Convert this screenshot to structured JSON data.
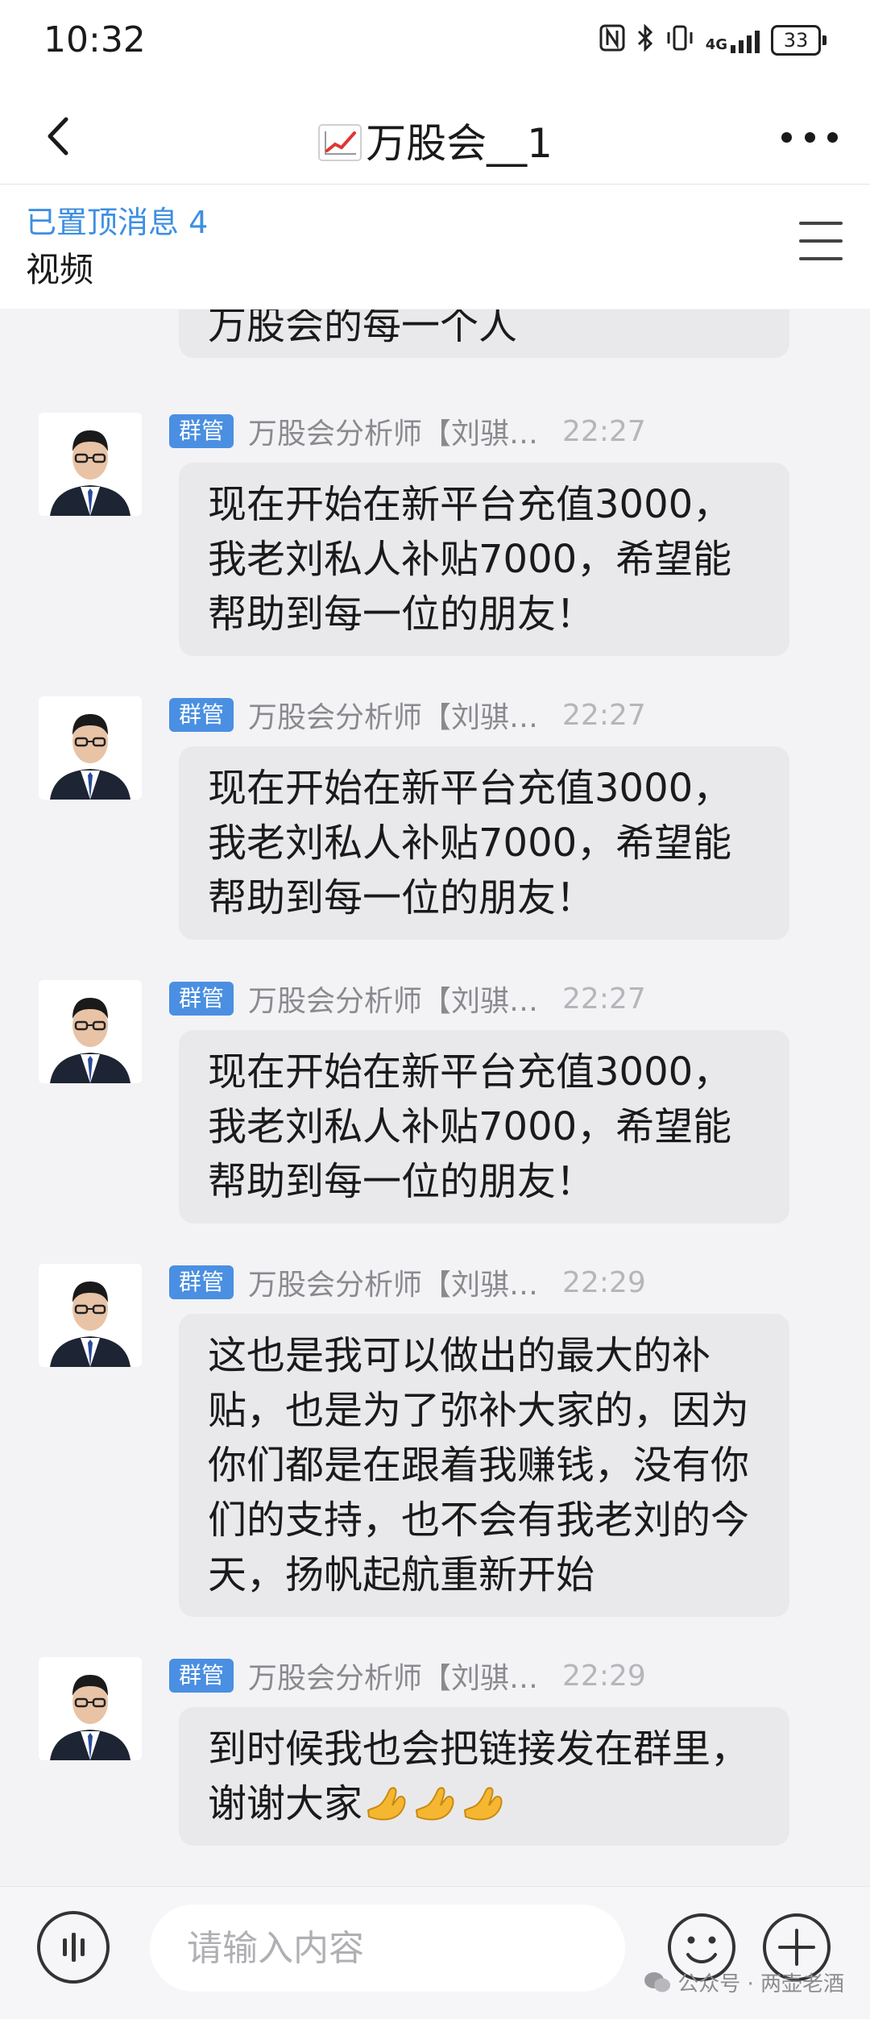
{
  "status_bar": {
    "time": "10:32",
    "network_label": "4G",
    "battery": "33",
    "icons": [
      "nfc-icon",
      "bluetooth-icon",
      "vibrate-icon",
      "signal-icon",
      "battery-icon"
    ]
  },
  "header": {
    "title": "万股会__1",
    "title_icon": "chart-increasing-emoji"
  },
  "pinned": {
    "label": "已置顶消息 4",
    "content": "视频"
  },
  "chat": {
    "partial_message": "万股会的每一个人",
    "messages": [
      {
        "badge": "群管",
        "sender": "万股会分析师【刘骐…",
        "time": "22:27",
        "text": "现在开始在新平台充值3000，我老刘私人补贴7000，希望能帮助到每一位的朋友！"
      },
      {
        "badge": "群管",
        "sender": "万股会分析师【刘骐…",
        "time": "22:27",
        "text": "现在开始在新平台充值3000，我老刘私人补贴7000，希望能帮助到每一位的朋友！"
      },
      {
        "badge": "群管",
        "sender": "万股会分析师【刘骐…",
        "time": "22:27",
        "text": "现在开始在新平台充值3000，我老刘私人补贴7000，希望能帮助到每一位的朋友！"
      },
      {
        "badge": "群管",
        "sender": "万股会分析师【刘骐…",
        "time": "22:29",
        "text": "这也是我可以做出的最大的补贴，也是为了弥补大家的，因为你们都是在跟着我赚钱，没有你们的支持，也不会有我老刘的今天，扬帆起航重新开始"
      },
      {
        "badge": "群管",
        "sender": "万股会分析师【刘骐…",
        "time": "22:29",
        "text": "到时候我也会把链接发在群里，谢谢大家"
      }
    ]
  },
  "input": {
    "placeholder": "请输入内容"
  },
  "watermark": "公众号 · 两壶老酒",
  "colors": {
    "accent": "#3d8fe0",
    "badge": "#4a8fe2",
    "bubble": "#e9e9ec",
    "background": "#f3f3f6"
  }
}
